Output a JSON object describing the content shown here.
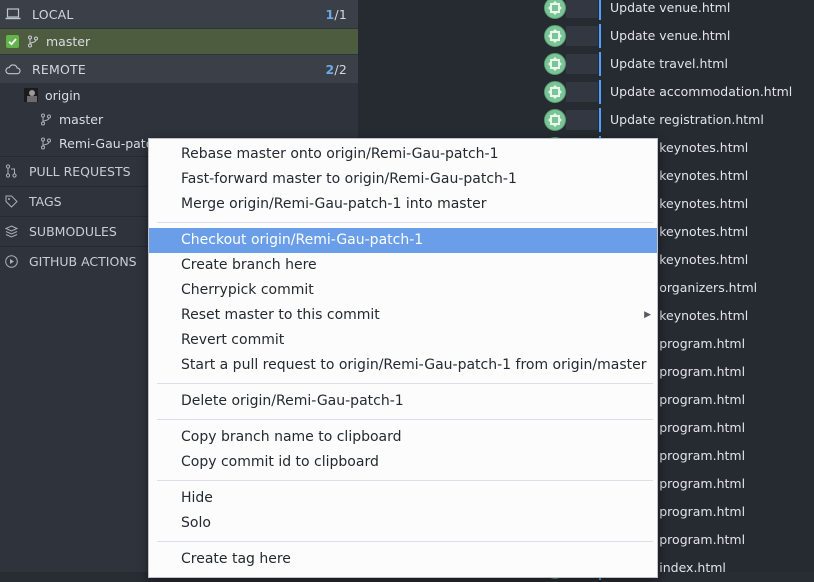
{
  "sidebar": {
    "local": {
      "label": "LOCAL",
      "count_current": "1",
      "count_total": "/1"
    },
    "local_branches": [
      {
        "name": "master",
        "checked": true
      }
    ],
    "remote": {
      "label": "REMOTE",
      "count_current": "2",
      "count_total": "/2"
    },
    "remote_name": "origin",
    "remote_branches": [
      {
        "name": "master"
      },
      {
        "name": "Remi-Gau-patch-1"
      }
    ],
    "collapsed_sections": [
      {
        "label": "PULL REQUESTS",
        "icon": "pull-request-icon"
      },
      {
        "label": "TAGS",
        "icon": "tag-icon"
      },
      {
        "label": "SUBMODULES",
        "icon": "submodule-icon"
      },
      {
        "label": "GITHUB ACTIONS",
        "icon": "play-circle-icon"
      }
    ]
  },
  "commits": [
    "Update venue.html",
    "Update venue.html",
    "Update travel.html",
    "Update accommodation.html",
    "Update registration.html",
    "Update keynotes.html",
    "Update keynotes.html",
    "Update keynotes.html",
    "Update keynotes.html",
    "Update keynotes.html",
    "Update organizers.html",
    "Update keynotes.html",
    "Update program.html",
    "Update program.html",
    "Update program.html",
    "Update program.html",
    "Update program.html",
    "Update program.html",
    "Update program.html",
    "Update program.html",
    "Update index.html"
  ],
  "context_menu": {
    "items": [
      {
        "label": "Rebase master onto origin/Remi-Gau-patch-1"
      },
      {
        "label": "Fast-forward master to origin/Remi-Gau-patch-1"
      },
      {
        "label": "Merge origin/Remi-Gau-patch-1 into master"
      },
      {
        "label": "Checkout origin/Remi-Gau-patch-1",
        "highlighted": true
      },
      {
        "label": "Create branch here"
      },
      {
        "label": "Cherrypick commit"
      },
      {
        "label": "Reset master to this commit",
        "has_submenu": true
      },
      {
        "label": "Revert commit"
      },
      {
        "label": "Start a pull request to origin/Remi-Gau-patch-1 from origin/master"
      },
      {
        "label": "Delete origin/Remi-Gau-patch-1"
      },
      {
        "label": "Copy branch name to clipboard"
      },
      {
        "label": "Copy commit id to clipboard"
      },
      {
        "label": "Hide"
      },
      {
        "label": "Solo"
      },
      {
        "label": "Create tag here"
      }
    ]
  },
  "colors": {
    "accent": "#6ea8e6",
    "selection": "#4d5b3f",
    "menu_highlight": "#6a9ee8",
    "avatar": "#7ac596"
  }
}
